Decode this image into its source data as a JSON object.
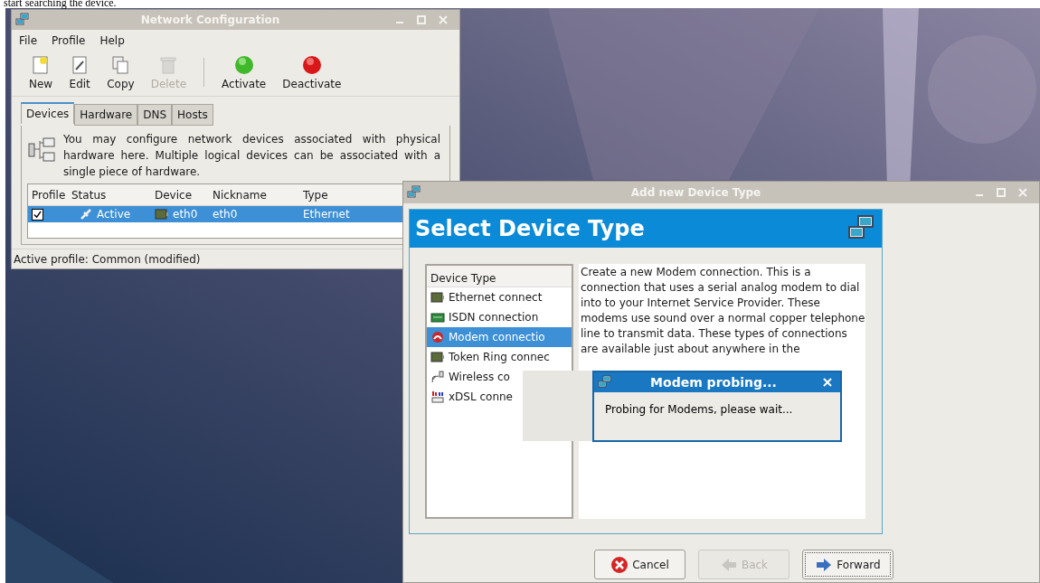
{
  "page_caption": "start searching the device.",
  "network_window": {
    "title": "Network Configuration",
    "menu": [
      "File",
      "Profile",
      "Help"
    ],
    "toolbar": [
      {
        "label": "New",
        "kind": "new",
        "disabled": false
      },
      {
        "label": "Edit",
        "kind": "edit",
        "disabled": false
      },
      {
        "label": "Copy",
        "kind": "copy",
        "disabled": false
      },
      {
        "label": "Delete",
        "kind": "delete",
        "disabled": true
      },
      {
        "label": "Activate",
        "kind": "activate",
        "disabled": false
      },
      {
        "label": "Deactivate",
        "kind": "deactivate",
        "disabled": false
      }
    ],
    "tabs": [
      {
        "label": "Devices",
        "selected": true
      },
      {
        "label": "Hardware",
        "selected": false
      },
      {
        "label": "DNS",
        "selected": false
      },
      {
        "label": "Hosts",
        "selected": false
      }
    ],
    "info_text": "You may configure network devices associated with physical hardware here.  Multiple logical devices can be associated with a single piece of hardware.",
    "table": {
      "columns": [
        "Profile",
        "Status",
        "Device",
        "Nickname",
        "Type"
      ],
      "rows": [
        {
          "checked": true,
          "selected": true,
          "status": "Active",
          "device": "eth0",
          "nickname": "eth0",
          "type": "Ethernet"
        }
      ]
    },
    "status_bar": "Active profile: Common (modified)"
  },
  "device_window": {
    "title": "Add new Device Type",
    "heading": "Select Device Type",
    "list_header": "Device Type",
    "device_types": [
      {
        "label": "Ethernet connect",
        "kind": "ethernet",
        "selected": false
      },
      {
        "label": "ISDN connection",
        "kind": "isdn",
        "selected": false
      },
      {
        "label": "Modem connectio",
        "kind": "modem",
        "selected": true
      },
      {
        "label": "Token Ring connec",
        "kind": "ethernet",
        "selected": false
      },
      {
        "label": "Wireless co",
        "kind": "wireless",
        "selected": false
      },
      {
        "label": "xDSL conne",
        "kind": "xdsl",
        "selected": false
      }
    ],
    "description": "Create a new Modem connection.  This is a connection that uses a serial analog modem to dial into to your Internet Service Provider. These modems use sound over a normal copper telephone line to transmit data.  These types of connections are available just about anywhere in the",
    "buttons": [
      {
        "label": "Cancel",
        "kind": "cancel",
        "disabled": false
      },
      {
        "label": "Back",
        "kind": "back",
        "disabled": true
      },
      {
        "label": "Forward",
        "kind": "forward",
        "disabled": false
      }
    ]
  },
  "probe_dialog": {
    "title": "Modem probing...",
    "message": "Probing for Modems, please wait..."
  }
}
